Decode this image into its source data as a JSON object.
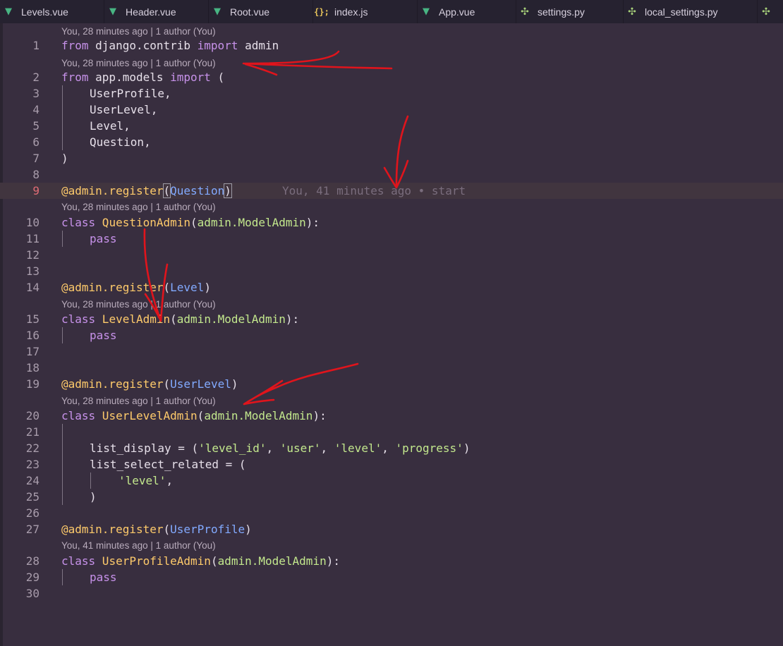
{
  "tabs": [
    {
      "label": "Levels.vue",
      "icon": "vue-icon"
    },
    {
      "label": "Header.vue",
      "icon": "vue-icon"
    },
    {
      "label": "Root.vue",
      "icon": "vue-icon"
    },
    {
      "label": "index.js",
      "icon": "js-icon"
    },
    {
      "label": "App.vue",
      "icon": "vue-icon"
    },
    {
      "label": "settings.py",
      "icon": "python-icon"
    },
    {
      "label": "local_settings.py",
      "icon": "python-icon"
    }
  ],
  "codelens": {
    "before_1": "You, 28 minutes ago | 1 author (You)",
    "before_2": "You, 28 minutes ago | 1 author (You)",
    "before_10": "You, 28 minutes ago | 1 author (You)",
    "before_15": "You, 28 minutes ago | 1 author (You)",
    "before_20": "You, 28 minutes ago | 1 author (You)",
    "before_28": "You, 41 minutes ago | 1 author (You)"
  },
  "inline_blame": "You, 41 minutes ago • start",
  "code": {
    "l1": {
      "n": "1",
      "a": "from",
      "b": " django.contrib ",
      "c": "import",
      "d": " admin"
    },
    "l2": {
      "n": "2",
      "a": "from",
      "b": " app.models ",
      "c": "import",
      "d": " ("
    },
    "l3": {
      "n": "3",
      "t": "UserProfile,"
    },
    "l4": {
      "n": "4",
      "t": "UserLevel,"
    },
    "l5": {
      "n": "5",
      "t": "Level,"
    },
    "l6": {
      "n": "6",
      "t": "Question,"
    },
    "l7": {
      "n": "7",
      "t": ")"
    },
    "l8": {
      "n": "8"
    },
    "l9": {
      "n": "9",
      "dec": "@admin.register",
      "p1": "(",
      "arg": "Question",
      "p2": ")"
    },
    "l10": {
      "n": "10",
      "kw": "class",
      "name": " QuestionAdmin",
      "p1": "(",
      "base": "admin.ModelAdmin",
      "p2": "):"
    },
    "l11": {
      "n": "11",
      "t": "pass"
    },
    "l12": {
      "n": "12"
    },
    "l13": {
      "n": "13"
    },
    "l14": {
      "n": "14",
      "dec": "@admin.register",
      "p1": "(",
      "arg": "Level",
      "p2": ")"
    },
    "l15": {
      "n": "15",
      "kw": "class",
      "name": " LevelAdmin",
      "p1": "(",
      "base": "admin.ModelAdmin",
      "p2": "):"
    },
    "l16": {
      "n": "16",
      "t": "pass"
    },
    "l17": {
      "n": "17"
    },
    "l18": {
      "n": "18"
    },
    "l19": {
      "n": "19",
      "dec": "@admin.register",
      "p1": "(",
      "arg": "UserLevel",
      "p2": ")"
    },
    "l20": {
      "n": "20",
      "kw": "class",
      "name": " UserLevelAdmin",
      "p1": "(",
      "base": "admin.ModelAdmin",
      "p2": "):"
    },
    "l21": {
      "n": "21"
    },
    "l22": {
      "n": "22",
      "a": "list_display = (",
      "s1": "'level_id'",
      "c1": ", ",
      "s2": "'user'",
      "c2": ", ",
      "s3": "'level'",
      "c3": ", ",
      "s4": "'progress'",
      "e": ")"
    },
    "l23": {
      "n": "23",
      "t": "list_select_related = ("
    },
    "l24": {
      "n": "24",
      "s": "'level'",
      "e": ","
    },
    "l25": {
      "n": "25",
      "t": ")"
    },
    "l26": {
      "n": "26"
    },
    "l27": {
      "n": "27",
      "dec": "@admin.register",
      "p1": "(",
      "arg": "UserProfile",
      "p2": ")"
    },
    "l28": {
      "n": "28",
      "kw": "class",
      "name": " UserProfileAdmin",
      "p1": "(",
      "base": "admin.ModelAdmin",
      "p2": "):"
    },
    "l29": {
      "n": "29",
      "t": "pass"
    },
    "l30": {
      "n": "30"
    }
  }
}
